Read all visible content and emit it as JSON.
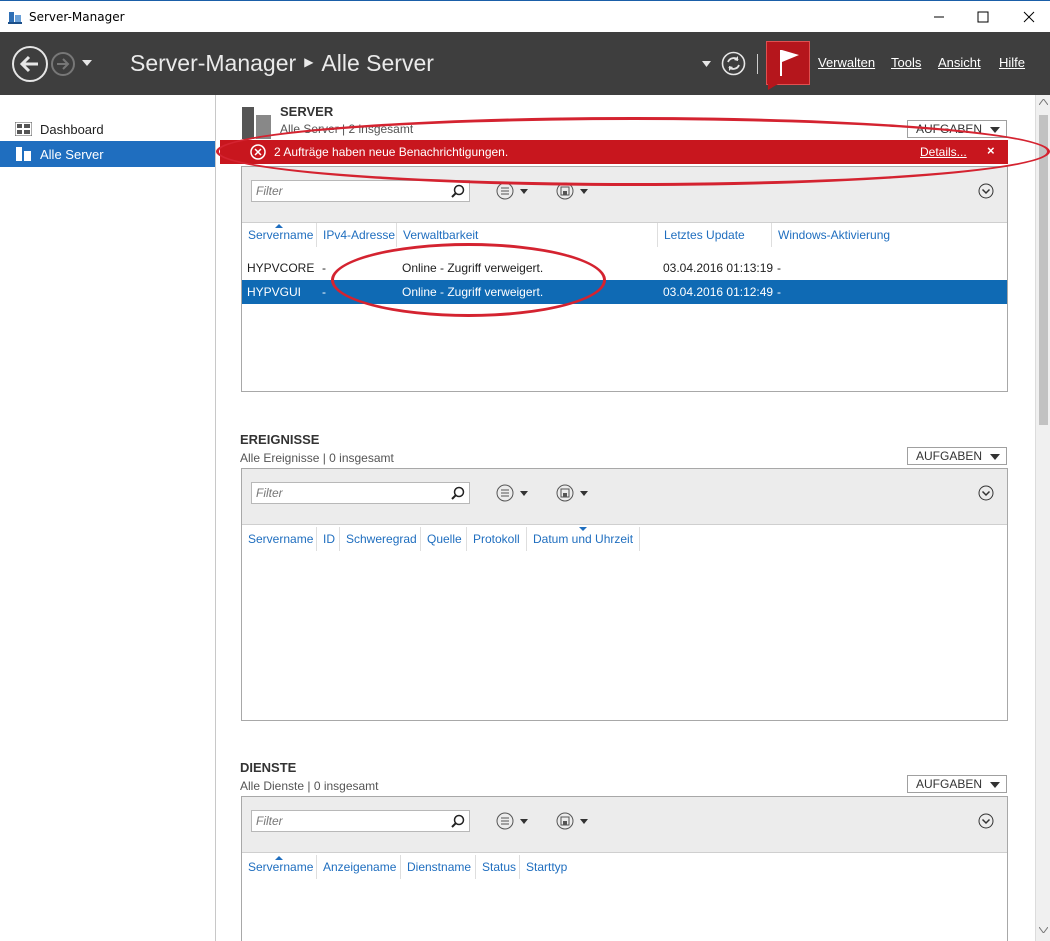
{
  "window": {
    "title": "Server-Manager"
  },
  "header": {
    "crumb_app": "Server-Manager",
    "crumb_page": "Alle Server",
    "menu": [
      "Verwalten",
      "Tools",
      "Ansicht",
      "Hilfe"
    ]
  },
  "sidebar": {
    "items": [
      {
        "label": "Dashboard",
        "icon": "dashboard-icon"
      },
      {
        "label": "Alle Server",
        "icon": "server-icon"
      }
    ]
  },
  "notification": {
    "message": "2 Aufträge haben neue Benachrichtigungen.",
    "details": "Details...",
    "close": "×"
  },
  "server_section": {
    "title": "SERVER",
    "subtitle": "Alle Server | 2 insgesamt",
    "tasks": "AUFGABEN",
    "filter_placeholder": "Filter",
    "columns": [
      "Servername",
      "IPv4-Adresse",
      "Verwaltbarkeit",
      "Letztes Update",
      "Windows-Aktivierung"
    ],
    "rows": [
      [
        "HYPVCORE",
        "-",
        "Online - Zugriff verweigert.",
        "03.04.2016 01:13:19",
        "-"
      ],
      [
        "HYPVGUI",
        "-",
        "Online - Zugriff verweigert.",
        "03.04.2016 01:12:49",
        "-"
      ]
    ]
  },
  "events_section": {
    "title": "EREIGNISSE",
    "subtitle": "Alle Ereignisse | 0 insgesamt",
    "tasks": "AUFGABEN",
    "filter_placeholder": "Filter",
    "columns": [
      "Servername",
      "ID",
      "Schweregrad",
      "Quelle",
      "Protokoll",
      "Datum und Uhrzeit"
    ]
  },
  "services_section": {
    "title": "DIENSTE",
    "subtitle": "Alle Dienste | 0 insgesamt",
    "tasks": "AUFGABEN",
    "filter_placeholder": "Filter",
    "columns": [
      "Servername",
      "Anzeigename",
      "Dienstname",
      "Status",
      "Starttyp"
    ]
  },
  "colors": {
    "header_bg": "#3e3e3e",
    "accent": "#1f6ebf",
    "notification_bg": "#c8161e",
    "annotation": "#d42330"
  }
}
